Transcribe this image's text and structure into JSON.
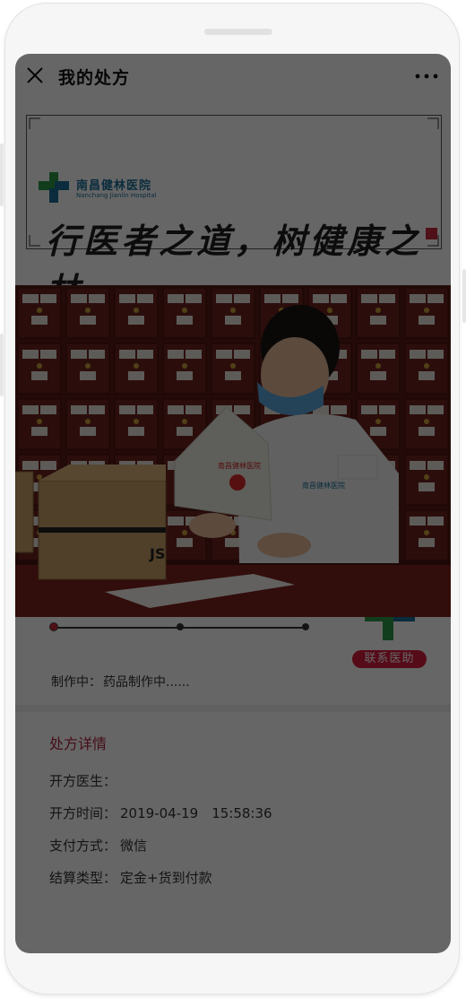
{
  "nav": {
    "title": "我的处方",
    "close_icon": "close-icon",
    "more_icon": "more-icon"
  },
  "banner": {
    "hospital_name": "南昌健林医院",
    "hospital_name_en": "Nanchang Jianlin Hospital",
    "slogan": "行医者之道，树健康之林"
  },
  "photo": {
    "bag_label": "南昌健林医院",
    "coat_label": "南昌健林医院",
    "box_label": "JS"
  },
  "progress": {
    "steps": 3,
    "current_step": 1,
    "contact_button": "联系医助"
  },
  "status": {
    "label": "制作中：",
    "text": "药品制作中......"
  },
  "details": {
    "title": "处方详情",
    "rows": [
      {
        "label": "开方医生：",
        "value": ""
      },
      {
        "label": "开方时间：",
        "value": "2019-04-19　15:58:36"
      },
      {
        "label": "支付方式：",
        "value": "微信"
      },
      {
        "label": "结算类型：",
        "value": "定金+货到付款"
      }
    ]
  },
  "colors": {
    "accent": "#d61d3d",
    "detail_title": "#b0223d",
    "brand_blue": "#1b6f98",
    "brand_green": "#2f9a4a"
  }
}
